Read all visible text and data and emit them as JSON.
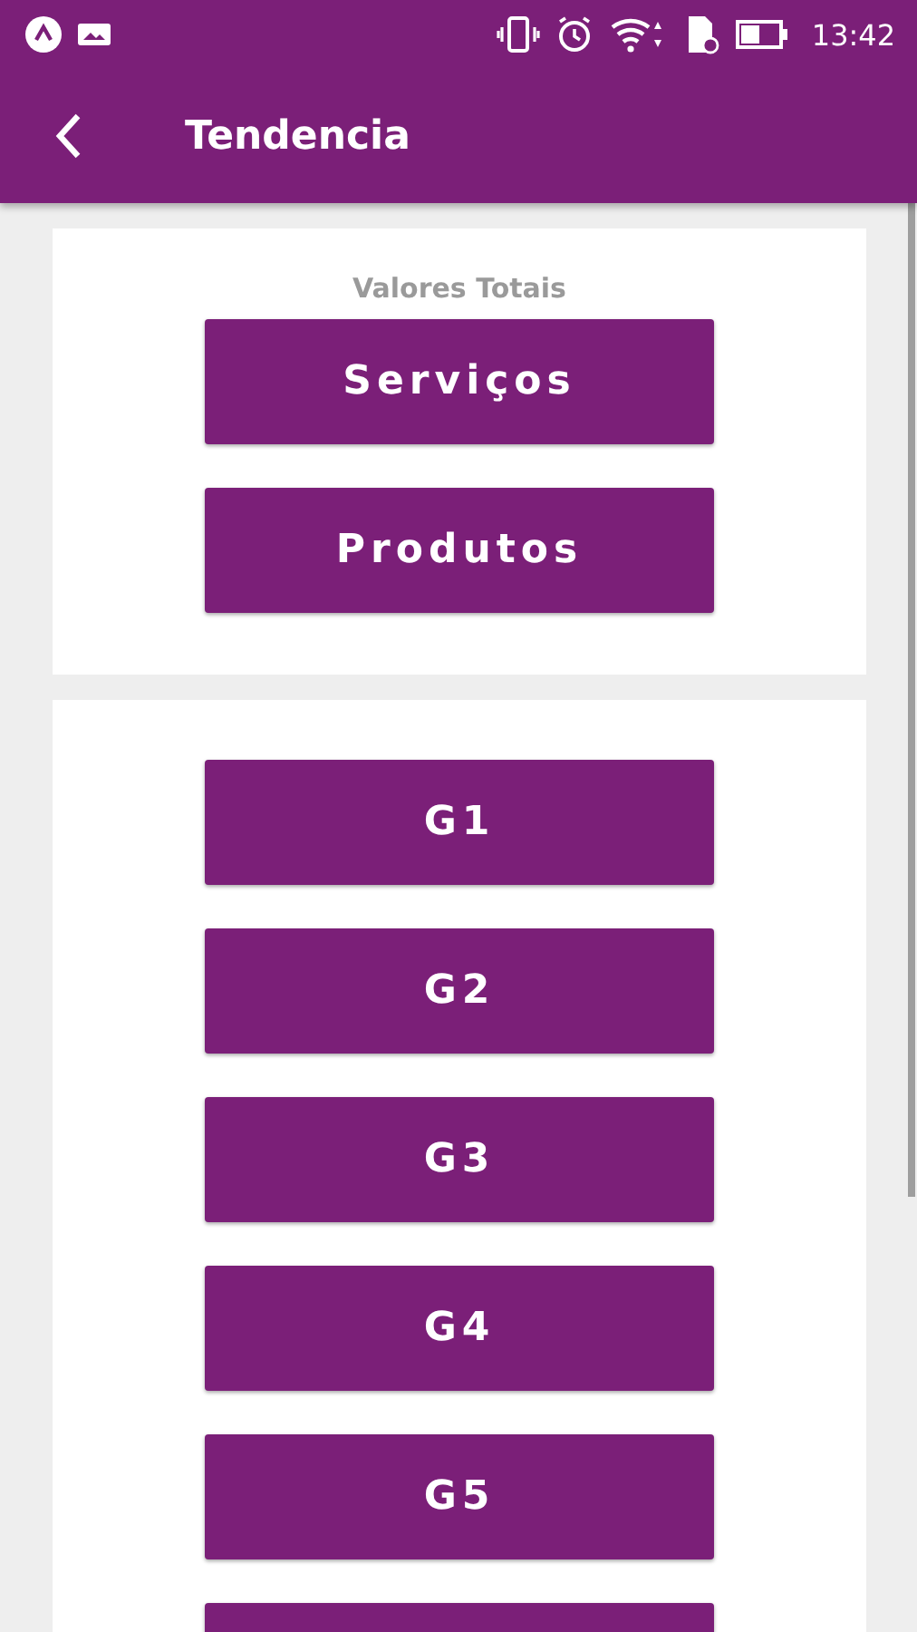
{
  "status_bar": {
    "time": "13:42"
  },
  "app_bar": {
    "title": "Tendencia"
  },
  "totals_card": {
    "heading": "Valores Totais",
    "buttons": [
      "Serviços",
      "Produtos"
    ]
  },
  "groups_card": {
    "buttons": [
      "G1",
      "G2",
      "G3",
      "G4",
      "G5"
    ]
  }
}
